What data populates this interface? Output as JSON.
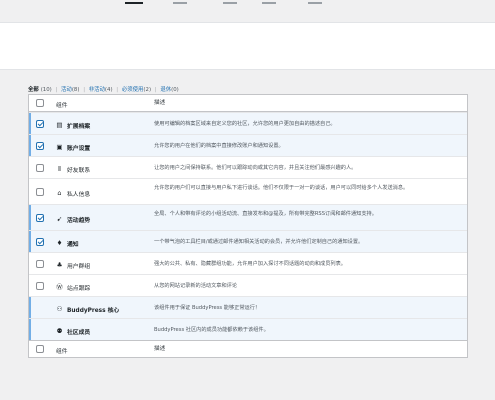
{
  "top_tabs": [
    {
      "label": "",
      "active": true
    },
    {
      "label": "",
      "active": false
    },
    {
      "label": "",
      "active": false
    },
    {
      "label": "",
      "active": false
    },
    {
      "label": "",
      "active": false
    }
  ],
  "filters": {
    "all": "全部",
    "all_count": "(10)",
    "active": "活动",
    "active_count": "(8)",
    "inactive": "非活动",
    "inactive_count": "(4)",
    "must_use": "必须使用",
    "must_use_count": "(2)",
    "dropins": "退休",
    "dropins_count": "(0)",
    "separator": "|"
  },
  "table": {
    "col_component": "组件",
    "col_description": "描述",
    "rows": [
      {
        "name": "扩展档案",
        "icon": "profile-icon",
        "glyph": "▤",
        "active": true,
        "checked": true,
        "description": "使用可编辑的档案区域来自定义您的社区，允许您的用户更加自由的描述自己。"
      },
      {
        "name": "账户设置",
        "icon": "settings-icon",
        "glyph": "▣",
        "active": true,
        "checked": true,
        "description": "允许您的用户在他们的档案中直接修改账户和通知设置。"
      },
      {
        "name": "好友联系",
        "icon": "friends-icon",
        "glyph": "⦀",
        "active": false,
        "checked": false,
        "description": "让您的用户之间保持联系。他们可以跟踪动向或其它内容，并且关注他们最感兴趣的人。"
      },
      {
        "name": "私人信息",
        "icon": "messages-icon",
        "glyph": "⌂",
        "active": false,
        "checked": false,
        "description": "允许您的用户们可以直接与用户私下进行谈话。他们不仅限于一对一的谈话，用户可以同时给多个人发送消息。"
      },
      {
        "name": "活动趋势",
        "icon": "activity-icon",
        "glyph": "➹",
        "active": true,
        "checked": true,
        "description": "全局、个人和带有评论的小组活动流、直接发布和@提及，所有带完整RSS订阅和邮件通知支持。"
      },
      {
        "name": "通知",
        "icon": "notification-icon",
        "glyph": "♦",
        "active": true,
        "checked": true,
        "description": "一个带气泡的工具栏目/或通过邮件通知相关活动的会员，并允许他们定制自己的通知设置。"
      },
      {
        "name": "用户群组",
        "icon": "groups-icon",
        "glyph": "♣",
        "active": false,
        "checked": false,
        "description": "强大的公共、私有、隐藏群组功能，允许用户加入探讨不同话题的动向和成员列表。"
      },
      {
        "name": "站点跟踪",
        "icon": "wordpress-icon",
        "glyph": "Ⓦ",
        "active": false,
        "checked": false,
        "description": "从您的网站记录新的活动文章和评论"
      },
      {
        "name": "BuddyPress 核心",
        "icon": "buddypress-icon",
        "glyph": "⚇",
        "active": true,
        "checked": false,
        "no_checkbox": true,
        "description": "该组件用于保证 BuddyPress 能够正常运行！"
      },
      {
        "name": "社区成员",
        "icon": "members-icon",
        "glyph": "⚉",
        "active": true,
        "checked": false,
        "no_checkbox": true,
        "description": "BuddyPress 社区内的成员功能都依赖于该组件。"
      }
    ]
  },
  "colors": {
    "active_row_bg": "#f0f6fc",
    "active_stripe": "#72aee6",
    "link": "#2271b1"
  }
}
